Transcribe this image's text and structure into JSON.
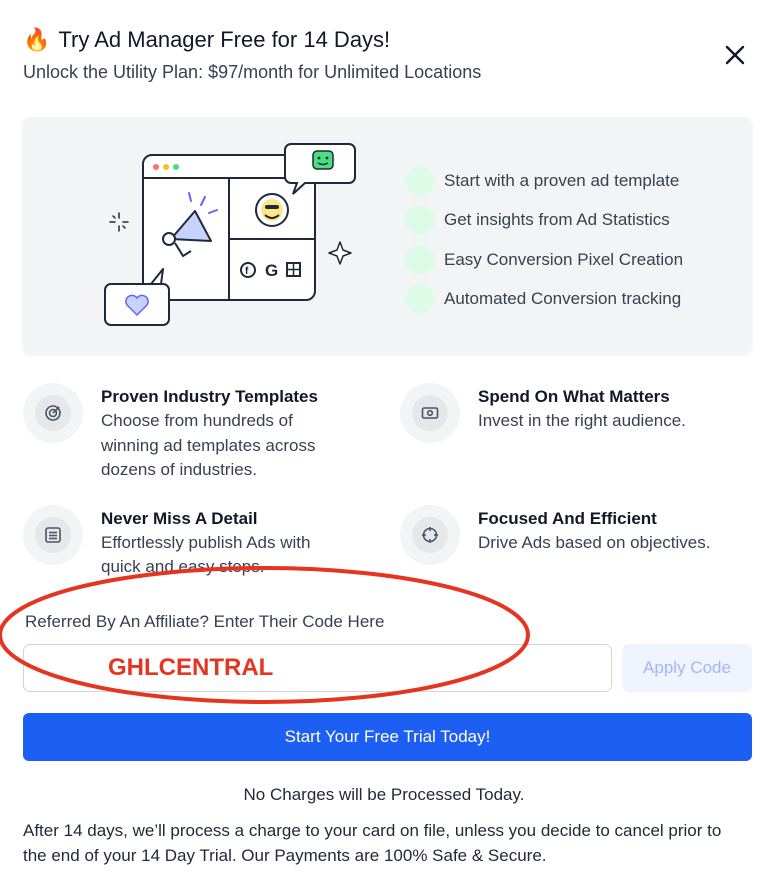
{
  "header": {
    "emoji": "🔥",
    "title": "Try Ad Manager Free for 14 Days!",
    "subtitle": "Unlock the Utility Plan: $97/month for Unlimited Locations"
  },
  "hero": {
    "benefits": [
      "Start with a proven ad template",
      "Get insights from Ad Statistics",
      "Easy Conversion Pixel Creation",
      "Automated Conversion tracking"
    ],
    "dot_color": "#dcfce7"
  },
  "features": [
    {
      "icon": "target-icon",
      "title": "Proven Industry Templates",
      "description": "Choose from hundreds of winning ad templates across dozens of industries."
    },
    {
      "icon": "money-icon",
      "title": "Spend On What Matters",
      "description": "Invest in the right audience."
    },
    {
      "icon": "list-icon",
      "title": "Never Miss A Detail",
      "description": "Effortlessly publish Ads with quick and easy steps."
    },
    {
      "icon": "crosshair-icon",
      "title": "Focused And Efficient",
      "description": "Drive Ads based on objectives."
    }
  ],
  "affiliate": {
    "label": "Referred By An Affiliate? Enter Their Code Here",
    "code_value": "GHLCENTRAL",
    "apply_label": "Apply Code"
  },
  "cta": {
    "label": "Start Your Free Trial Today!",
    "color": "#1d5ef3"
  },
  "no_charges": "No Charges will be Processed Today.",
  "fine_print": "After 14 days, we’ll process a charge to your card on file, unless you decide to cancel prior to the end of your 14 Day Trial. Our Payments are 100% Safe & Secure.",
  "annotation_color": "#e5341f"
}
